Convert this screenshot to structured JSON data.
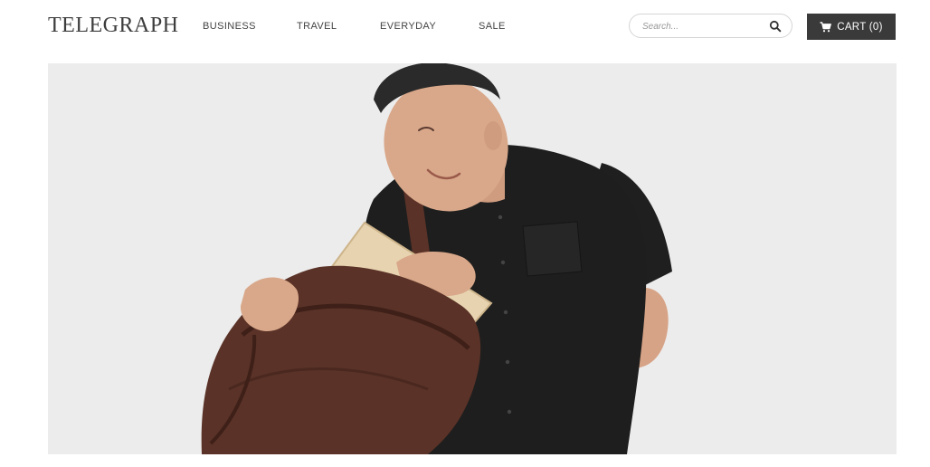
{
  "brand": {
    "logo": "TELEGRAPH"
  },
  "nav": {
    "items": [
      {
        "label": "BUSINESS"
      },
      {
        "label": "TRAVEL"
      },
      {
        "label": "EVERYDAY"
      },
      {
        "label": "SALE"
      }
    ]
  },
  "search": {
    "placeholder": "Search...",
    "icon": "search-icon"
  },
  "cart": {
    "label": "CART (0)",
    "icon": "cart-icon"
  },
  "hero": {
    "alt_subject": "man-with-leather-backpack",
    "background": "#ececec"
  },
  "colors": {
    "accent_dark": "#3a3a3a",
    "text": "#444444",
    "hero_bg": "#ececec",
    "bag_brown": "#5a3227",
    "shirt_black": "#1e1e1e",
    "skin": "#d9a88a",
    "tablet": "#e7d3b0"
  }
}
